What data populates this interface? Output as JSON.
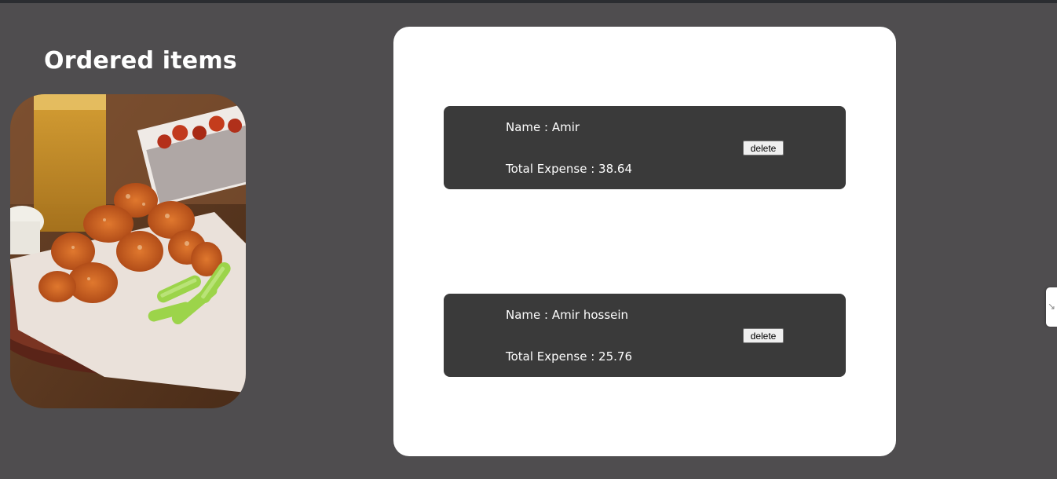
{
  "page": {
    "title": "Ordered items",
    "background": "#4f4d4f"
  },
  "hero_image": {
    "alt": "Fried chicken bites with celery"
  },
  "orders": [
    {
      "name_label": "Name : Amir",
      "total_label": "Total Expense : 38.64",
      "delete_label": "delete"
    },
    {
      "name_label": "Name : Amir hossein",
      "total_label": "Total Expense : 25.76",
      "delete_label": "delete"
    }
  ],
  "side_widget": {
    "icon": "feedback-icon"
  }
}
